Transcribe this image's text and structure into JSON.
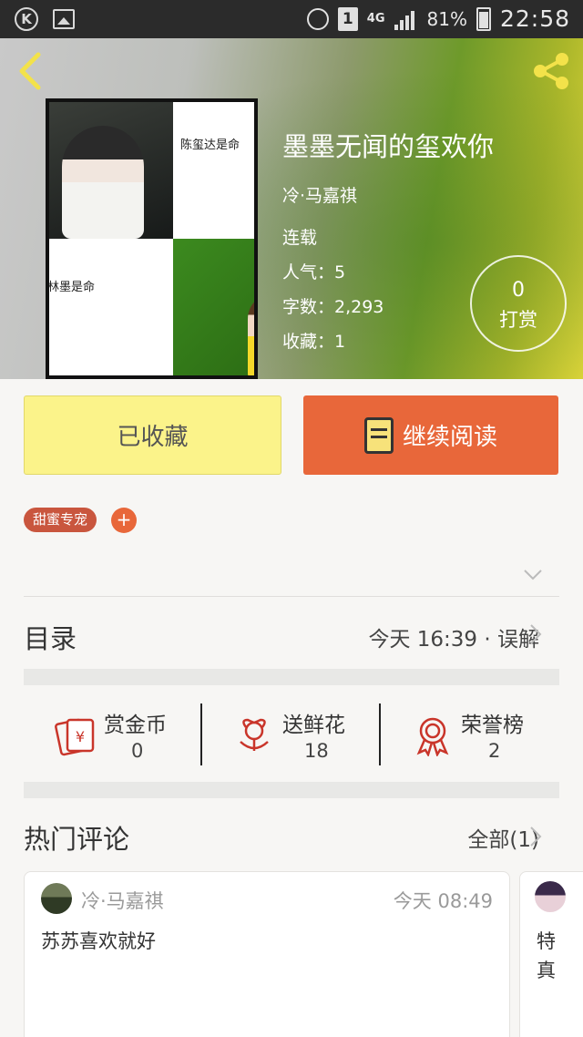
{
  "status_bar": {
    "clock": "22:58",
    "battery": "81%",
    "network": "4G",
    "sim": "1"
  },
  "book": {
    "title": "墨墨无闻的玺欢你",
    "author": "冷·马嘉祺",
    "status": "连载",
    "popularity": "人气：5",
    "word_count": "字数：2,293",
    "favorites": "收藏：1",
    "cover_caption_1": "陈玺达是命",
    "cover_caption_2": "林墨是命"
  },
  "reward": {
    "count": "0",
    "label": "打赏"
  },
  "actions": {
    "favorited_label": "已收藏",
    "continue_label": "继续阅读"
  },
  "tags": [
    "甜蜜专宠"
  ],
  "tag_add": "+",
  "catalog": {
    "title": "目录",
    "latest": "今天 16:39 · 误解"
  },
  "stats": [
    {
      "label": "赏金币",
      "value": "0"
    },
    {
      "label": "送鲜花",
      "value": "18"
    },
    {
      "label": "荣誉榜",
      "value": "2"
    }
  ],
  "comments_section": {
    "title": "热门评论",
    "all_label": "全部(1)"
  },
  "comments": [
    {
      "user": "冷·马嘉祺",
      "time": "今天 08:49",
      "text": "苏苏喜欢就好"
    },
    {
      "text_line1": "特",
      "text_line2": "真"
    }
  ],
  "colors": {
    "accent_orange": "#e8673a",
    "favorite_yellow": "#fbf38a",
    "tag_red": "#c9563e",
    "icon_red": "#c9352a"
  }
}
